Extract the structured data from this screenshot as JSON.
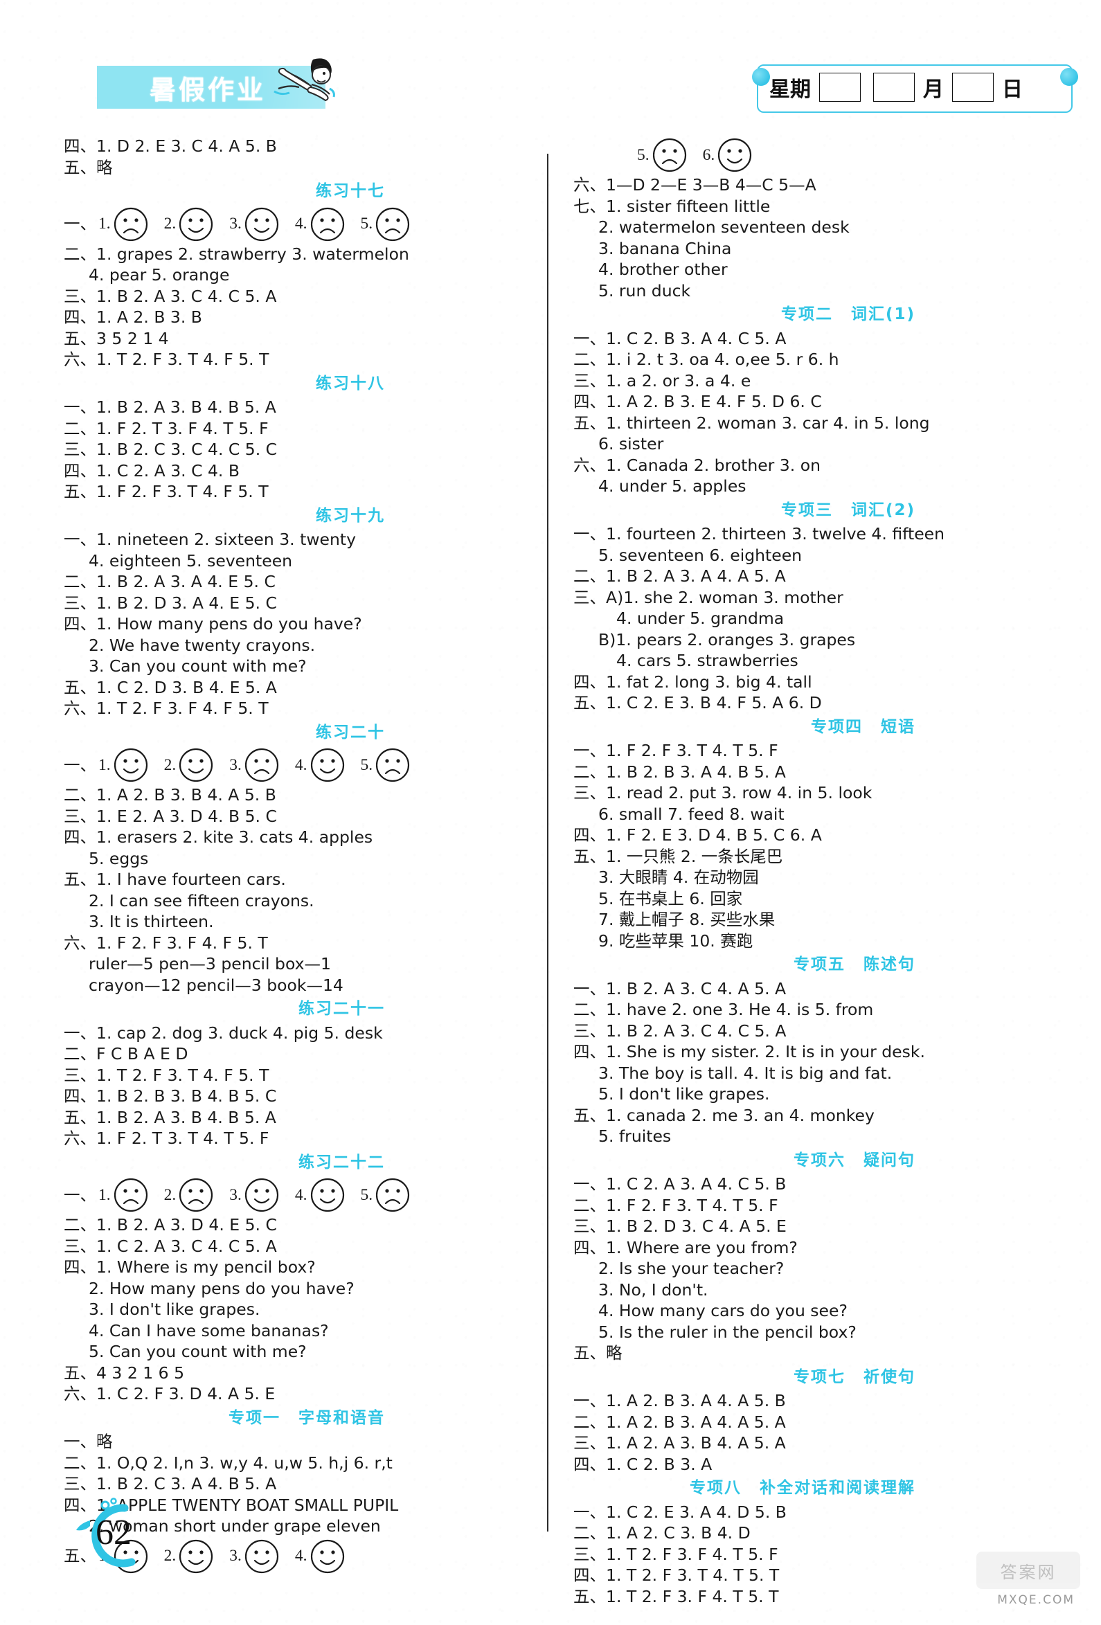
{
  "header": {
    "logo_text": "暑假作业",
    "mascot": "swimming-child-icon",
    "date_labels": {
      "weekday": "星期",
      "month": "月",
      "day": "日"
    },
    "accent_color": "#2fc4e4"
  },
  "page_number": "62",
  "watermark": "MXQE.COM",
  "watermark_logo": "答案网",
  "left_column": [
    {
      "type": "line",
      "text": "四、1. D   2. E   3. C   4. A   5. B"
    },
    {
      "type": "line",
      "text": "五、略"
    },
    {
      "type": "section",
      "label": "练习十七",
      "gap": ""
    },
    {
      "type": "faces",
      "prefix": "一、",
      "items": [
        {
          "n": "1.",
          "mood": "sad"
        },
        {
          "n": "2.",
          "mood": "happy"
        },
        {
          "n": "3.",
          "mood": "happy"
        },
        {
          "n": "4.",
          "mood": "sad"
        },
        {
          "n": "5.",
          "mood": "sad"
        }
      ]
    },
    {
      "type": "line",
      "text": "二、1. grapes   2. strawberry   3. watermelon"
    },
    {
      "type": "line",
      "indent": 1,
      "text": "4. pear   5. orange"
    },
    {
      "type": "line",
      "text": "三、1. B   2. A   3. C   4. C   5. A"
    },
    {
      "type": "line",
      "text": "四、1. A   2. B   3. B"
    },
    {
      "type": "line",
      "text": "五、3   5   2   1   4"
    },
    {
      "type": "line",
      "text": "六、1. T   2. F   3. T   4. F   5. T"
    },
    {
      "type": "section",
      "label": "练习十八",
      "gap": ""
    },
    {
      "type": "line",
      "text": "一、1. B   2. A   3. B   4. B   5. A"
    },
    {
      "type": "line",
      "text": "二、1. F   2. T   3. F   4. T   5. F"
    },
    {
      "type": "line",
      "text": "三、1. B   2. C   3. C   4. C   5. C"
    },
    {
      "type": "line",
      "text": "四、1. C   2. A   3. C   4. B"
    },
    {
      "type": "line",
      "text": "五、1. F   2. F   3. T   4. F   5. T"
    },
    {
      "type": "section",
      "label": "练习十九",
      "gap": ""
    },
    {
      "type": "line",
      "text": "一、1. nineteen   2. sixteen   3. twenty"
    },
    {
      "type": "line",
      "indent": 1,
      "text": "4. eighteen   5. seventeen"
    },
    {
      "type": "line",
      "text": "二、1. B   2. A   3. A   4. E   5. C"
    },
    {
      "type": "line",
      "text": "三、1. B   2. D   3. A   4. E   5. C"
    },
    {
      "type": "line",
      "text": "四、1. How many pens do you have?"
    },
    {
      "type": "line",
      "indent": 1,
      "text": "2. We have twenty crayons."
    },
    {
      "type": "line",
      "indent": 1,
      "text": "3. Can you count with me?"
    },
    {
      "type": "line",
      "text": "五、1. C   2. D   3. B   4. E   5. A"
    },
    {
      "type": "line",
      "text": "六、1. T   2. F   3. F   4. F   5. T"
    },
    {
      "type": "section",
      "label": "练习二十",
      "gap": ""
    },
    {
      "type": "faces",
      "prefix": "一、",
      "items": [
        {
          "n": "1.",
          "mood": "happy"
        },
        {
          "n": "2.",
          "mood": "happy"
        },
        {
          "n": "3.",
          "mood": "sad"
        },
        {
          "n": "4.",
          "mood": "happy"
        },
        {
          "n": "5.",
          "mood": "sad"
        }
      ]
    },
    {
      "type": "line",
      "text": "二、1. A   2. B   3. B   4. A   5. B"
    },
    {
      "type": "line",
      "text": "三、1. E   2. A   3. D   4. B   5. C"
    },
    {
      "type": "line",
      "text": "四、1. erasers   2. kite   3. cats   4. apples"
    },
    {
      "type": "line",
      "indent": 1,
      "text": "5. eggs"
    },
    {
      "type": "line",
      "text": "五、1. I have fourteen cars."
    },
    {
      "type": "line",
      "indent": 1,
      "text": "2. I can see fifteen crayons."
    },
    {
      "type": "line",
      "indent": 1,
      "text": "3. It is thirteen."
    },
    {
      "type": "line",
      "text": "六、1. F   2. F   3. F   4. F   5. T"
    },
    {
      "type": "line",
      "indent": 1,
      "text": "ruler—5   pen—3   pencil box—1"
    },
    {
      "type": "line",
      "indent": 1,
      "text": "crayon—12   pencil—3   book—14"
    },
    {
      "type": "section",
      "label": "练习二十一",
      "gap": ""
    },
    {
      "type": "line",
      "text": "一、1. cap   2. dog   3. duck   4. pig   5. desk"
    },
    {
      "type": "line",
      "text": "二、F   C   B   A   E   D"
    },
    {
      "type": "line",
      "text": "三、1. T   2. F   3. T   4. F   5. T"
    },
    {
      "type": "line",
      "text": "四、1. B   2. B   3. B   4. B   5. C"
    },
    {
      "type": "line",
      "text": "五、1. B   2. A   3. B   4. B   5. A"
    },
    {
      "type": "line",
      "text": "六、1. F   2. T   3. T   4. T   5. F"
    },
    {
      "type": "section",
      "label": "练习二十二",
      "gap": ""
    },
    {
      "type": "faces",
      "prefix": "一、",
      "items": [
        {
          "n": "1.",
          "mood": "sad"
        },
        {
          "n": "2.",
          "mood": "sad"
        },
        {
          "n": "3.",
          "mood": "happy"
        },
        {
          "n": "4.",
          "mood": "happy"
        },
        {
          "n": "5.",
          "mood": "sad"
        }
      ]
    },
    {
      "type": "line",
      "text": "二、1. B   2. A   3. D   4. E   5. C"
    },
    {
      "type": "line",
      "text": "三、1. C   2. A   3. C   4. C   5. A"
    },
    {
      "type": "line",
      "text": "四、1. Where is my pencil box?"
    },
    {
      "type": "line",
      "indent": 1,
      "text": "2. How many pens do you have?"
    },
    {
      "type": "line",
      "indent": 1,
      "text": "3. I don't like grapes."
    },
    {
      "type": "line",
      "indent": 1,
      "text": "4. Can I have some bananas?"
    },
    {
      "type": "line",
      "indent": 1,
      "text": "5. Can you count with me?"
    },
    {
      "type": "line",
      "text": "五、4   3   2   1   6   5"
    },
    {
      "type": "line",
      "text": "六、1. C   2. F   3. D   4. A   5. E"
    },
    {
      "type": "section",
      "label": "专项一",
      "gap": "字母和语音"
    },
    {
      "type": "line",
      "text": "一、略"
    },
    {
      "type": "line",
      "text": "二、1. O,Q   2. I,n   3. w,y   4. u,w   5. h,j   6. r,t"
    },
    {
      "type": "line",
      "text": "三、1. B   2. C   3. A   4. B   5. A"
    },
    {
      "type": "line",
      "text": "四、1. APPLE  TWENTY  BOAT  SMALL  PUPIL"
    },
    {
      "type": "line",
      "indent": 1,
      "text": "2. woman   short   under   grape   eleven"
    },
    {
      "type": "faces",
      "prefix": "五、",
      "items": [
        {
          "n": "1.",
          "mood": "happy"
        },
        {
          "n": "2.",
          "mood": "happy"
        },
        {
          "n": "3.",
          "mood": "happy"
        },
        {
          "n": "4.",
          "mood": "happy"
        }
      ]
    }
  ],
  "right_column": [
    {
      "type": "faces",
      "prefix": "",
      "indentpx": 92,
      "items": [
        {
          "n": "5.",
          "mood": "sad"
        },
        {
          "n": "6.",
          "mood": "happy"
        }
      ]
    },
    {
      "type": "line",
      "text": "六、1—D   2—E   3—B   4—C   5—A"
    },
    {
      "type": "line",
      "text": "七、1. sister   fifteen   little"
    },
    {
      "type": "line",
      "indent": 1,
      "text": "2. watermelon   seventeen   desk"
    },
    {
      "type": "line",
      "indent": 1,
      "text": "3. banana   China"
    },
    {
      "type": "line",
      "indent": 1,
      "text": "4. brother   other"
    },
    {
      "type": "line",
      "indent": 1,
      "text": "5. run   duck"
    },
    {
      "type": "section",
      "label": "专项二",
      "gap": "词汇(1)"
    },
    {
      "type": "line",
      "text": "一、1. C   2. B   3. A   4. C   5. A"
    },
    {
      "type": "line",
      "text": "二、1. i   2. t   3. oa   4. o,ee   5. r   6. h"
    },
    {
      "type": "line",
      "text": "三、1. a   2. or   3. a   4. e"
    },
    {
      "type": "line",
      "text": "四、1. A   2. B   3. E   4. F   5. D   6. C"
    },
    {
      "type": "line",
      "text": "五、1. thirteen   2. woman   3. car   4. in   5. long"
    },
    {
      "type": "line",
      "indent": 1,
      "text": "6. sister"
    },
    {
      "type": "line",
      "text": "六、1. Canada   2. brother   3. on"
    },
    {
      "type": "line",
      "indent": 1,
      "text": "4. under   5. apples"
    },
    {
      "type": "section",
      "label": "专项三",
      "gap": "词汇(2)"
    },
    {
      "type": "line",
      "text": "一、1. fourteen   2. thirteen   3. twelve   4. fifteen"
    },
    {
      "type": "line",
      "indent": 1,
      "text": "5. seventeen   6. eighteen"
    },
    {
      "type": "line",
      "text": "二、1. B   2. A   3. A   4. A   5. A"
    },
    {
      "type": "line",
      "text": "三、A)1. she   2. woman   3. mother"
    },
    {
      "type": "line",
      "indent": 2,
      "text": "4. under   5. grandma"
    },
    {
      "type": "line",
      "indent": 1,
      "text": "B)1. pears   2. oranges   3. grapes"
    },
    {
      "type": "line",
      "indent": 2,
      "text": "4. cars   5. strawberries"
    },
    {
      "type": "line",
      "text": "四、1. fat   2. long   3. big   4. tall"
    },
    {
      "type": "line",
      "text": "五、1. C   2. E   3. B   4. F   5. A   6. D"
    },
    {
      "type": "section",
      "label": "专项四",
      "gap": "短语"
    },
    {
      "type": "line",
      "text": "一、1. F   2. F   3. T   4. T   5. F"
    },
    {
      "type": "line",
      "text": "二、1. B   2. B   3. A   4. B   5. A"
    },
    {
      "type": "line",
      "text": "三、1. read   2. put   3. row   4. in   5. look"
    },
    {
      "type": "line",
      "indent": 1,
      "text": "6. small   7. feed   8. wait"
    },
    {
      "type": "line",
      "text": "四、1. F   2. E   3. D   4. B   5. C   6. A"
    },
    {
      "type": "line",
      "text": "五、1. 一只熊   2. 一条长尾巴"
    },
    {
      "type": "line",
      "indent": 1,
      "text": "3. 大眼睛   4. 在动物园"
    },
    {
      "type": "line",
      "indent": 1,
      "text": "5. 在书桌上   6. 回家"
    },
    {
      "type": "line",
      "indent": 1,
      "text": "7. 戴上帽子   8. 买些水果"
    },
    {
      "type": "line",
      "indent": 1,
      "text": "9. 吃些苹果   10. 赛跑"
    },
    {
      "type": "section",
      "label": "专项五",
      "gap": "陈述句"
    },
    {
      "type": "line",
      "text": "一、1. B   2. A   3. C   4. A   5. A"
    },
    {
      "type": "line",
      "text": "二、1. have   2. one   3. He   4. is   5. from"
    },
    {
      "type": "line",
      "text": "三、1. B   2. A   3. C   4. C   5. A"
    },
    {
      "type": "line",
      "text": "四、1. She is my sister.   2. It is in your desk."
    },
    {
      "type": "line",
      "indent": 1,
      "text": "3. The boy is tall.   4. It is big and fat."
    },
    {
      "type": "line",
      "indent": 1,
      "text": "5. I don't like grapes."
    },
    {
      "type": "line",
      "text": "五、1. canada   2. me   3. an   4. monkey"
    },
    {
      "type": "line",
      "indent": 1,
      "text": "5. fruites"
    },
    {
      "type": "section",
      "label": "专项六",
      "gap": "疑问句"
    },
    {
      "type": "line",
      "text": "一、1. C   2. A   3. A   4. C   5. B"
    },
    {
      "type": "line",
      "text": "二、1. F   2. F   3. T   4. T   5. F"
    },
    {
      "type": "line",
      "text": "三、1. B   2. D   3. C   4. A   5. E"
    },
    {
      "type": "line",
      "text": "四、1. Where are you from?"
    },
    {
      "type": "line",
      "indent": 1,
      "text": "2. Is she your teacher?"
    },
    {
      "type": "line",
      "indent": 1,
      "text": "3. No, I don't."
    },
    {
      "type": "line",
      "indent": 1,
      "text": "4. How many cars do you see?"
    },
    {
      "type": "line",
      "indent": 1,
      "text": "5. Is the ruler in the pencil box?"
    },
    {
      "type": "line",
      "text": "五、略"
    },
    {
      "type": "section",
      "label": "专项七",
      "gap": "祈使句"
    },
    {
      "type": "line",
      "text": "一、1. A   2. B   3. A   4. A   5. B"
    },
    {
      "type": "line",
      "text": "二、1. A   2. B   3. A   4. A   5. A"
    },
    {
      "type": "line",
      "text": "三、1. A   2. A   3. B   4. A   5. A"
    },
    {
      "type": "line",
      "text": "四、1. C   2. B   3. A"
    },
    {
      "type": "section",
      "label": "专项八",
      "gap": "补全对话和阅读理解"
    },
    {
      "type": "line",
      "text": "一、1. C   2. E   3. A   4. D   5. B"
    },
    {
      "type": "line",
      "text": "二、1. A   2. C   3. B   4. D"
    },
    {
      "type": "line",
      "text": "三、1. T   2. F   3. F   4. T   5. F"
    },
    {
      "type": "line",
      "text": "四、1. T   2. F   3. T   4. T   5. T"
    },
    {
      "type": "line",
      "text": "五、1. T   2. F   3. F   4. T   5. T"
    }
  ]
}
